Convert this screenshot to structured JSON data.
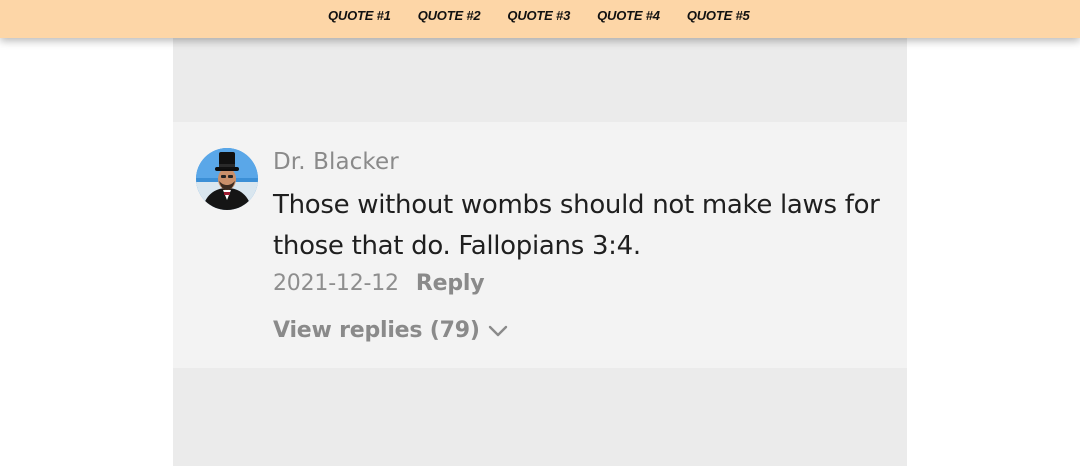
{
  "nav": {
    "items": [
      {
        "label": "QUOTE #1"
      },
      {
        "label": "QUOTE #2"
      },
      {
        "label": "QUOTE #3"
      },
      {
        "label": "QUOTE #4"
      },
      {
        "label": "QUOTE #5"
      }
    ]
  },
  "comment": {
    "author": "Dr. Blacker",
    "text": "Those without wombs should not make laws for those that do. Fallopians 3:4.",
    "date": "2021-12-12",
    "reply_label": "Reply",
    "view_replies_label": "View replies (79)"
  },
  "colors": {
    "topbar": "#fdd6a7",
    "screenshot_bg": "#ebebeb",
    "comment_bg": "#f3f3f3",
    "muted_text": "#8a8a8a",
    "body_text": "#1f1f1f"
  },
  "icons": {
    "expand": "chevron-down-icon",
    "avatar": "avatar"
  }
}
